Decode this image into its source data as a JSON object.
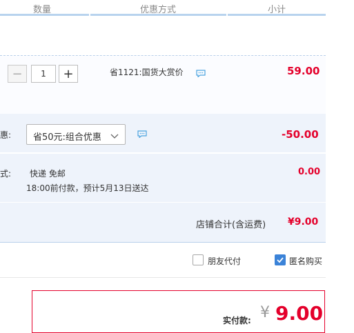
{
  "header": {
    "col_quantity": "数量",
    "col_discount": "优惠方式",
    "col_subtotal": "小计"
  },
  "item": {
    "quantity": "1",
    "minus": "−",
    "plus": "+",
    "discount_text": "省1121:国货大赏价",
    "price": "59.00"
  },
  "combo": {
    "label": "惠:",
    "selected": "省50元:组合优惠",
    "amount": "-50.00"
  },
  "shipping": {
    "label": "式:",
    "method": "快递 免邮",
    "note": "18:00前付款，预计5月13日送达",
    "amount": "0.00"
  },
  "store_total": {
    "label": "店铺合计(含运费)",
    "amount": "¥9.00"
  },
  "options": {
    "friend_pay": {
      "label": "朋友代付",
      "checked": false
    },
    "anonymous": {
      "label": "匿名购买",
      "checked": true
    }
  },
  "payment": {
    "label": "实付款:",
    "currency": "¥",
    "amount": "9.00"
  },
  "colors": {
    "accent_red": "#e4002b",
    "checkbox_blue": "#3b83d8",
    "row_bg": "#eef3fb"
  },
  "icons": {
    "chat": "chat-bubble-icon",
    "dropdown": "chevron-down-icon",
    "check": "check-icon"
  }
}
